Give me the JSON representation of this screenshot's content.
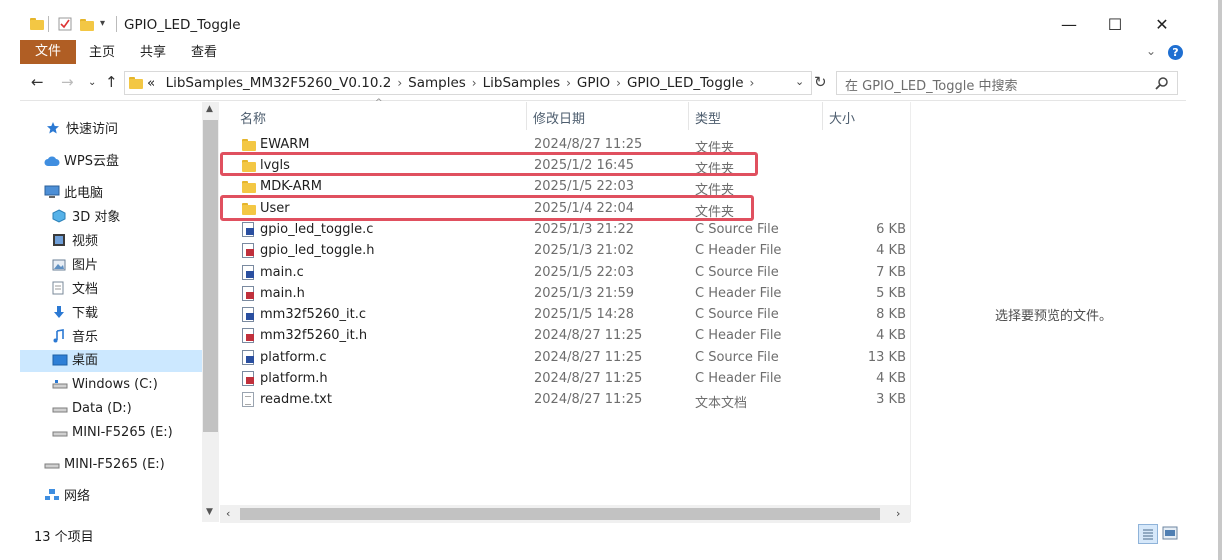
{
  "window": {
    "title": "GPIO_LED_Toggle",
    "minimize": "—",
    "maximize": "☐",
    "close": "✕"
  },
  "ribbon": {
    "tabs": [
      "文件",
      "主页",
      "共享",
      "查看"
    ]
  },
  "address": {
    "prefix": "«",
    "crumbs": [
      "LibSamples_MM32F5260_V0.10.2",
      "Samples",
      "LibSamples",
      "GPIO",
      "GPIO_LED_Toggle"
    ],
    "search_placeholder": "在 GPIO_LED_Toggle 中搜索"
  },
  "nav": {
    "items": [
      {
        "label": "快速访问",
        "icon": "star-icon"
      },
      {
        "label": "WPS云盘",
        "icon": "cloud-icon"
      },
      {
        "label": "此电脑",
        "icon": "computer-icon"
      },
      {
        "label": "3D 对象",
        "icon": "cube-icon"
      },
      {
        "label": "视频",
        "icon": "video-icon"
      },
      {
        "label": "图片",
        "icon": "picture-icon"
      },
      {
        "label": "文档",
        "icon": "document-icon"
      },
      {
        "label": "下载",
        "icon": "download-icon"
      },
      {
        "label": "音乐",
        "icon": "music-icon"
      },
      {
        "label": "桌面",
        "icon": "desktop-icon"
      },
      {
        "label": "Windows (C:)",
        "icon": "drive-icon"
      },
      {
        "label": "Data (D:)",
        "icon": "drive-icon"
      },
      {
        "label": "MINI-F5265 (E:)",
        "icon": "drive-icon"
      },
      {
        "label": "MINI-F5265 (E:)",
        "icon": "usb-drive-icon"
      },
      {
        "label": "网络",
        "icon": "network-icon"
      }
    ],
    "selected": "桌面"
  },
  "columns": [
    "名称",
    "修改日期",
    "类型",
    "大小"
  ],
  "files": [
    {
      "name": "EWARM",
      "date": "2024/8/27 11:25",
      "type": "文件夹",
      "size": "",
      "icon": "folder-icon"
    },
    {
      "name": "lvgls",
      "date": "2025/1/2 16:45",
      "type": "文件夹",
      "size": "",
      "icon": "folder-icon"
    },
    {
      "name": "MDK-ARM",
      "date": "2025/1/5 22:03",
      "type": "文件夹",
      "size": "",
      "icon": "folder-icon"
    },
    {
      "name": "User",
      "date": "2025/1/4 22:04",
      "type": "文件夹",
      "size": "",
      "icon": "folder-icon"
    },
    {
      "name": "gpio_led_toggle.c",
      "date": "2025/1/3 21:22",
      "type": "C Source File",
      "size": "6 KB",
      "icon": "c-source-icon"
    },
    {
      "name": "gpio_led_toggle.h",
      "date": "2025/1/3 21:02",
      "type": "C Header File",
      "size": "4 KB",
      "icon": "c-header-icon"
    },
    {
      "name": "main.c",
      "date": "2025/1/5 22:03",
      "type": "C Source File",
      "size": "7 KB",
      "icon": "c-source-icon"
    },
    {
      "name": "main.h",
      "date": "2025/1/3 21:59",
      "type": "C Header File",
      "size": "5 KB",
      "icon": "c-header-icon"
    },
    {
      "name": "mm32f5260_it.c",
      "date": "2025/1/5 14:28",
      "type": "C Source File",
      "size": "8 KB",
      "icon": "c-source-icon"
    },
    {
      "name": "mm32f5260_it.h",
      "date": "2024/8/27 11:25",
      "type": "C Header File",
      "size": "4 KB",
      "icon": "c-header-icon"
    },
    {
      "name": "platform.c",
      "date": "2024/8/27 11:25",
      "type": "C Source File",
      "size": "13 KB",
      "icon": "c-source-icon"
    },
    {
      "name": "platform.h",
      "date": "2024/8/27 11:25",
      "type": "C Header File",
      "size": "4 KB",
      "icon": "c-header-icon"
    },
    {
      "name": "readme.txt",
      "date": "2024/8/27 11:25",
      "type": "文本文档",
      "size": "3 KB",
      "icon": "text-file-icon"
    }
  ],
  "highlighted": [
    "lvgls",
    "User"
  ],
  "preview": {
    "text": "选择要预览的文件。"
  },
  "status": {
    "count": "13 个项目"
  },
  "colors": {
    "accent": "#b05e24",
    "highlight": "#e0505f",
    "selection": "#cce8ff"
  }
}
